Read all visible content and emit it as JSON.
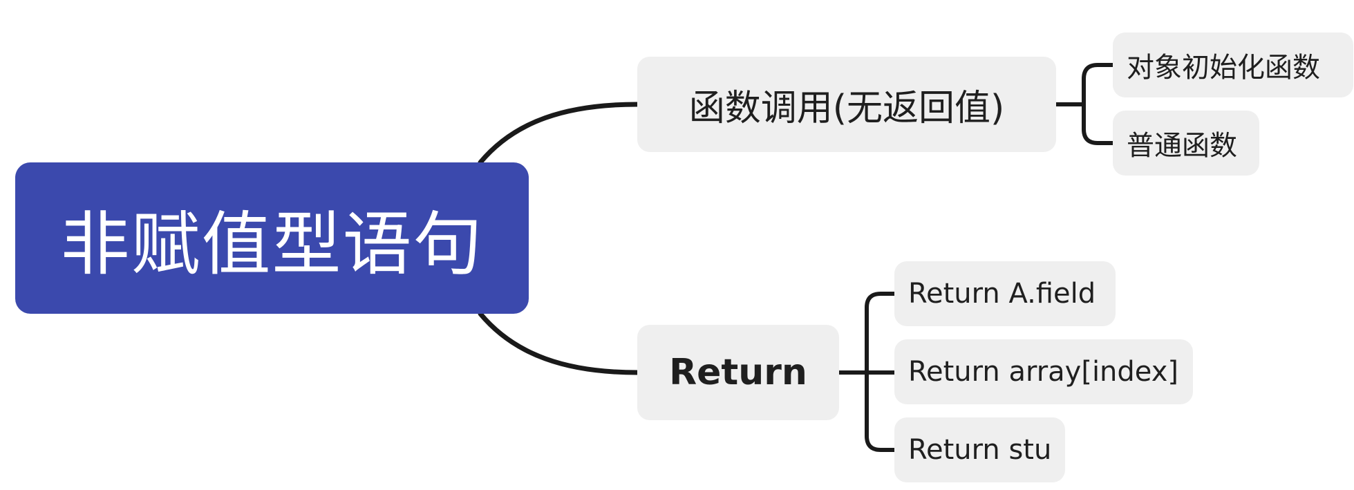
{
  "root": {
    "label": "非赋值型语句"
  },
  "branches": [
    {
      "label": "函数调用(无返回值)",
      "children": [
        {
          "label": "对象初始化函数"
        },
        {
          "label": "普通函数"
        }
      ]
    },
    {
      "label": "Return",
      "children": [
        {
          "label": "Return A.field"
        },
        {
          "label": "Return array[index]"
        },
        {
          "label": "Return stu"
        }
      ]
    }
  ],
  "colors": {
    "root_fill": "#3b49ad",
    "node_fill": "#efefef",
    "connector": "#1a1a1a"
  }
}
